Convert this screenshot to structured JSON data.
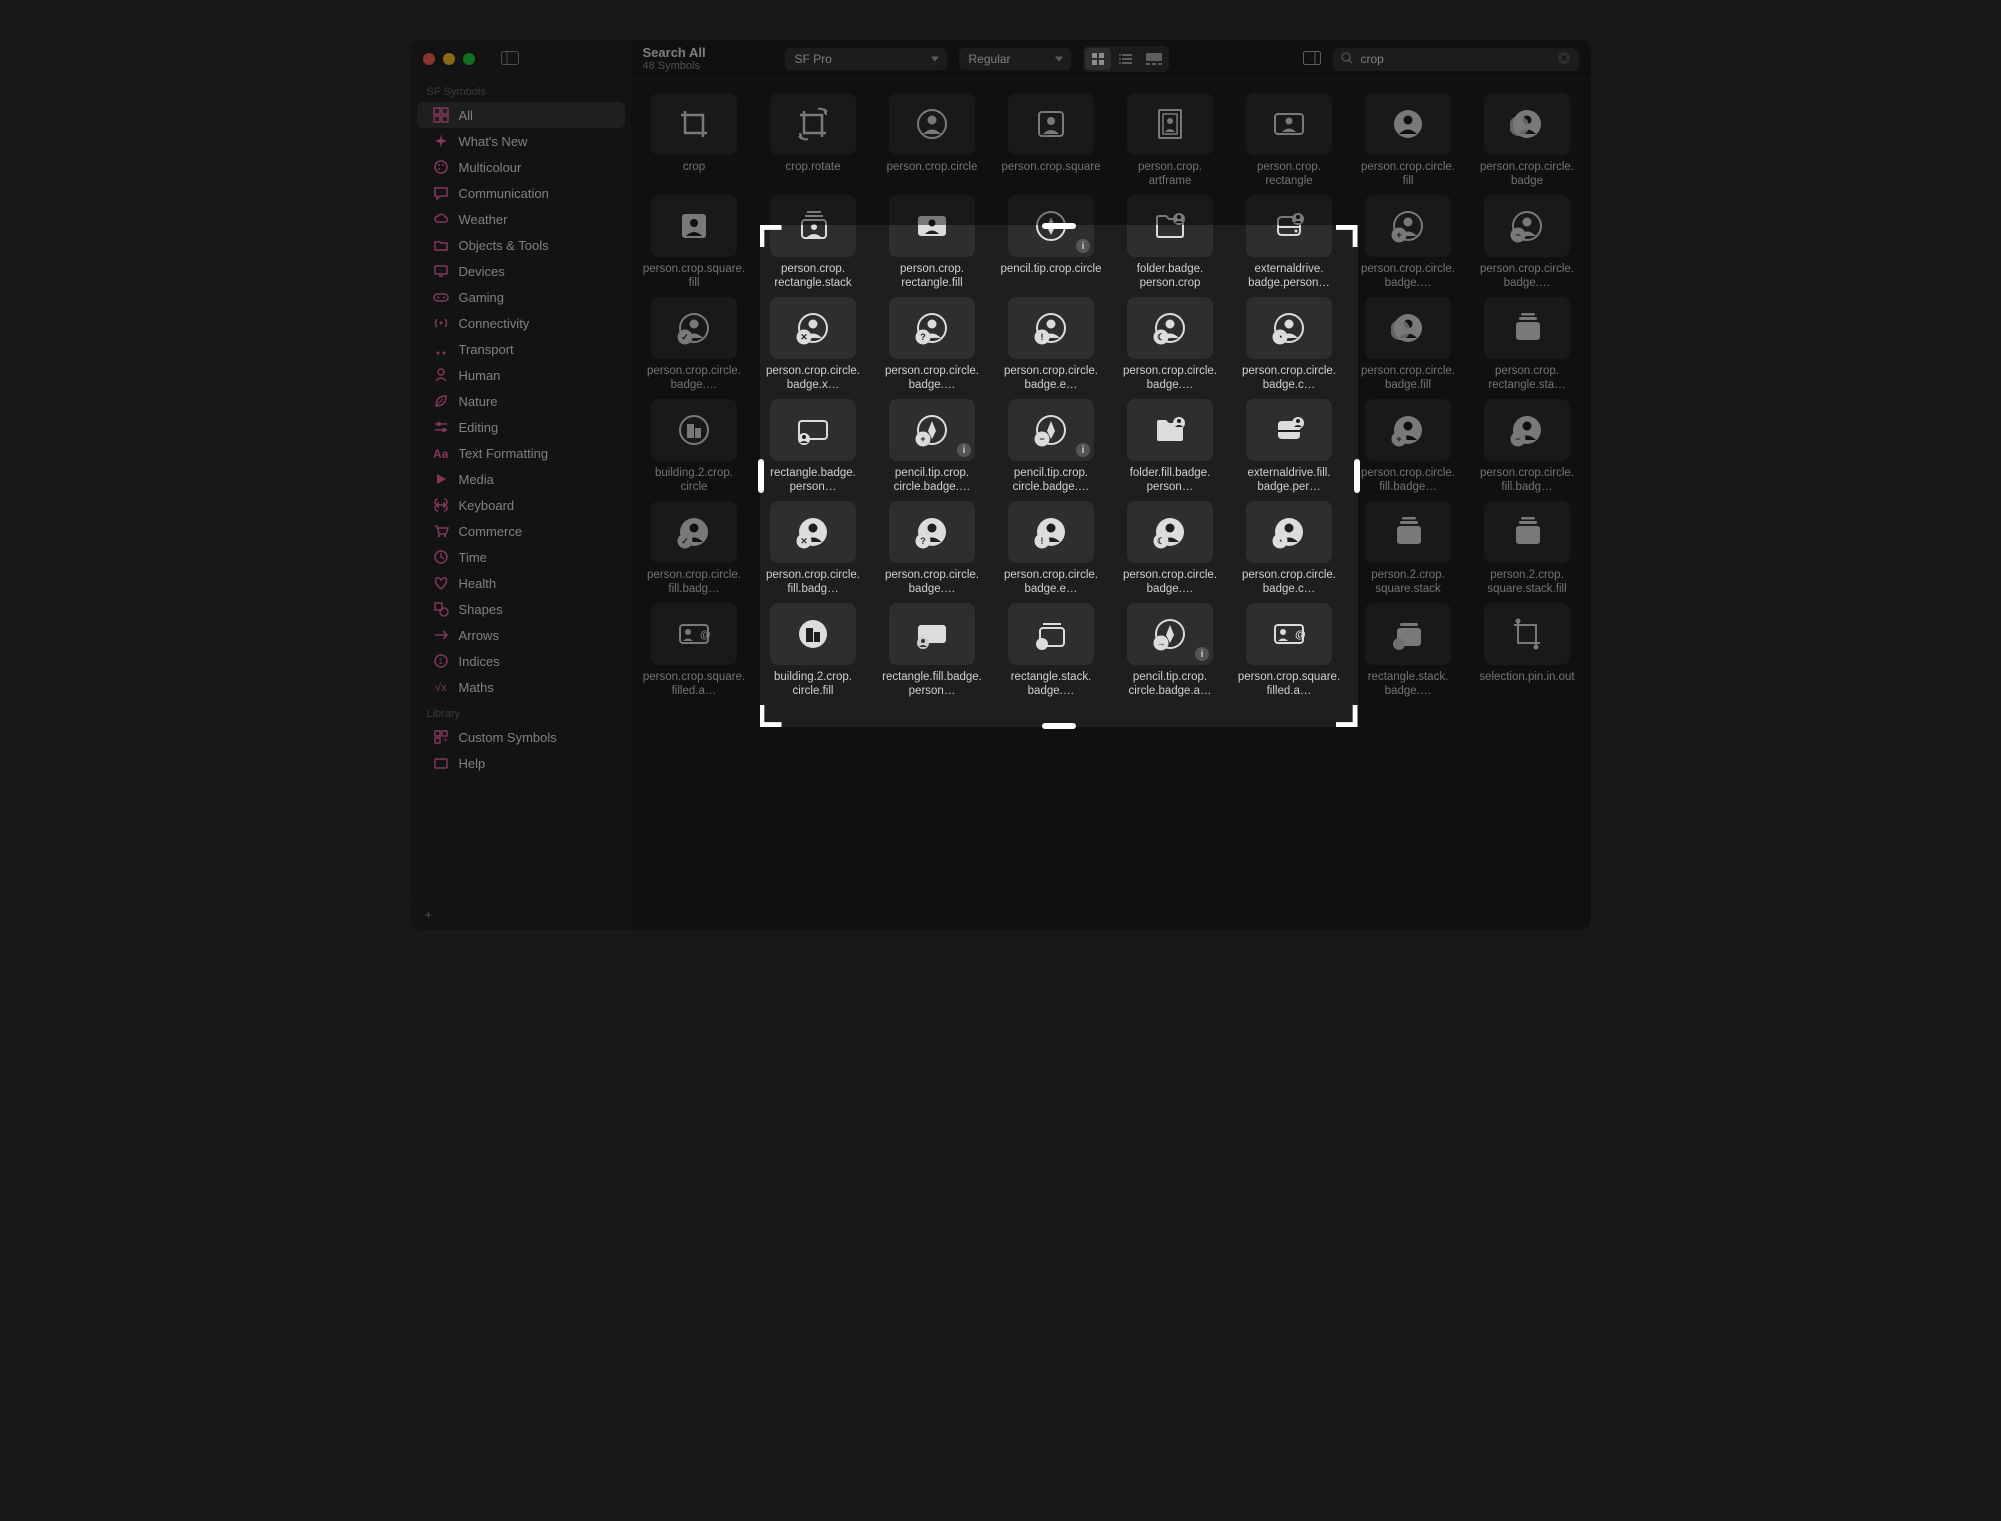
{
  "header": {
    "title": "Search All",
    "subtitle": "48 Symbols",
    "font_dropdown": "SF Pro",
    "weight_dropdown": "Regular",
    "search_value": "crop"
  },
  "sidebar": {
    "section1_label": "SF Symbols",
    "section2_label": "Library",
    "items1": [
      {
        "icon": "grid",
        "label": "All",
        "selected": true
      },
      {
        "icon": "sparkle",
        "label": "What's New"
      },
      {
        "icon": "palette",
        "label": "Multicolour"
      },
      {
        "icon": "bubble",
        "label": "Communication"
      },
      {
        "icon": "cloud",
        "label": "Weather"
      },
      {
        "icon": "folder",
        "label": "Objects & Tools"
      },
      {
        "icon": "display",
        "label": "Devices"
      },
      {
        "icon": "gamectrl",
        "label": "Gaming"
      },
      {
        "icon": "antenna",
        "label": "Connectivity"
      },
      {
        "icon": "car",
        "label": "Transport"
      },
      {
        "icon": "person",
        "label": "Human"
      },
      {
        "icon": "leaf",
        "label": "Nature"
      },
      {
        "icon": "slider",
        "label": "Editing"
      },
      {
        "icon": "textformat",
        "label": "Text Formatting"
      },
      {
        "icon": "play",
        "label": "Media"
      },
      {
        "icon": "command",
        "label": "Keyboard"
      },
      {
        "icon": "cart",
        "label": "Commerce"
      },
      {
        "icon": "clock",
        "label": "Time"
      },
      {
        "icon": "heart",
        "label": "Health"
      },
      {
        "icon": "shape",
        "label": "Shapes"
      },
      {
        "icon": "arrow",
        "label": "Arrows"
      },
      {
        "icon": "index",
        "label": "Indices"
      },
      {
        "icon": "math",
        "label": "Maths"
      }
    ],
    "items2": [
      {
        "icon": "custom",
        "label": "Custom Symbols"
      },
      {
        "icon": "help",
        "label": "Help"
      }
    ]
  },
  "symbols": [
    {
      "name": "crop",
      "i": "crop"
    },
    {
      "name": "crop.rotate",
      "i": "crop-rotate"
    },
    {
      "name": "person.crop.circle",
      "i": "pcc"
    },
    {
      "name": "person.crop.square",
      "i": "pcs"
    },
    {
      "name": "person.crop.artframe",
      "i": "paf"
    },
    {
      "name": "person.crop.rectangle",
      "i": "pcr"
    },
    {
      "name": "person.crop.circle.fill",
      "i": "pccf"
    },
    {
      "name": "person.crop.circle.badge",
      "i": "pccb"
    },
    {
      "name": "person.crop.square.fill",
      "i": "pcsf"
    },
    {
      "name": "person.crop.rectangle.stack",
      "i": "prs"
    },
    {
      "name": "person.crop.rectangle.fill",
      "i": "prf"
    },
    {
      "name": "pencil.tip.crop.circle",
      "i": "ptcc",
      "info": true
    },
    {
      "name": "folder.badge.person.crop",
      "i": "fbpc"
    },
    {
      "name": "externaldrive.badge.person.crop",
      "i": "edbp",
      "trunc": "externaldrive.badge.person…"
    },
    {
      "name": "person.crop.circle.badge.plus",
      "i": "pccbp",
      "trunc": "person.crop.circle.badge.…"
    },
    {
      "name": "person.crop.circle.badge.minus",
      "i": "pccbm",
      "trunc": "person.crop.circle.badge.…"
    },
    {
      "name": "person.crop.circle.badge.checkmark",
      "i": "pccbc",
      "trunc": "person.crop.circle.badge.…"
    },
    {
      "name": "person.crop.circle.badge.xmark",
      "i": "pccbx",
      "trunc": "person.crop.circle.badge.x…"
    },
    {
      "name": "person.crop.circle.badge.questionmark",
      "i": "pccbq",
      "trunc": "person.crop.circle.badge.…"
    },
    {
      "name": "person.crop.circle.badge.exclamationmark",
      "i": "pccbe",
      "trunc": "person.crop.circle.badge.e…"
    },
    {
      "name": "person.crop.circle.badge.moon",
      "i": "pccbmn",
      "trunc": "person.crop.circle.badge.…"
    },
    {
      "name": "person.crop.circle.badge.clock",
      "i": "pccbcl",
      "trunc": "person.crop.circle.badge.c…"
    },
    {
      "name": "person.crop.circle.badge.fill",
      "i": "pccbf"
    },
    {
      "name": "person.crop.rectangle.stack.fill",
      "i": "prsf",
      "trunc": "person.crop.rectangle.sta…"
    },
    {
      "name": "building.2.crop.circle",
      "i": "b2cc"
    },
    {
      "name": "rectangle.badge.person.crop",
      "i": "rbpc",
      "trunc": "rectangle.badge.person…"
    },
    {
      "name": "pencil.tip.crop.circle.badge.plus",
      "i": "ptccbp",
      "info": true,
      "trunc": "pencil.tip.crop.circle.badge.…"
    },
    {
      "name": "pencil.tip.crop.circle.badge.minus",
      "i": "ptccbm",
      "info": true,
      "trunc": "pencil.tip.crop.circle.badge.…"
    },
    {
      "name": "folder.fill.badge.person.crop",
      "i": "ffbpc",
      "trunc": "folder.fill.badge.person…"
    },
    {
      "name": "externaldrive.fill.badge.person.crop",
      "i": "efbpc",
      "trunc": "externaldrive.fill.badge.per…"
    },
    {
      "name": "person.crop.circle.fill.badge.plus",
      "i": "pccfbp",
      "trunc": "person.crop.circle.fill.badge…"
    },
    {
      "name": "person.crop.circle.fill.badge.minus",
      "i": "pccfbm",
      "trunc": "person.crop.circle.fill.badg…"
    },
    {
      "name": "person.crop.circle.fill.badge.checkmark",
      "i": "pccfbc",
      "trunc": "person.crop.circle.fill.badg…"
    },
    {
      "name": "person.crop.circle.fill.badge.xmark",
      "i": "pccfbx",
      "trunc": "person.crop.circle.fill.badg…"
    },
    {
      "name": "person.crop.circle.badge.questionmark.fill",
      "i": "pccbqf",
      "trunc": "person.crop.circle.badge.…"
    },
    {
      "name": "person.crop.circle.badge.exclamationmark.fill",
      "i": "pccbef",
      "trunc": "person.crop.circle.badge.e…"
    },
    {
      "name": "person.crop.circle.badge.moon.fill",
      "i": "pccbmf",
      "trunc": "person.crop.circle.badge.…"
    },
    {
      "name": "person.crop.circle.badge.clock.fill",
      "i": "pccbcf",
      "trunc": "person.crop.circle.badge.c…"
    },
    {
      "name": "person.2.crop.square.stack",
      "i": "p2css"
    },
    {
      "name": "person.2.crop.square.stack.fill",
      "i": "p2cssf"
    },
    {
      "name": "person.crop.square.filled.and.at.rectangle",
      "i": "pcsfar",
      "trunc": "person.crop.square.filled.a…"
    },
    {
      "name": "building.2.crop.circle.fill",
      "i": "b2ccf"
    },
    {
      "name": "rectangle.fill.badge.person.crop",
      "i": "rfbpc",
      "trunc": "rectangle.fill.badge.person…"
    },
    {
      "name": "rectangle.stack.badge.person.crop",
      "i": "rsbpc",
      "trunc": "rectangle.stack.badge.…"
    },
    {
      "name": "pencil.tip.crop.circle.badge.arrow.forward",
      "i": "ptccba",
      "info": true,
      "trunc": "pencil.tip.crop.circle.badge.a…"
    },
    {
      "name": "person.crop.square.filled.and.at.rectangle.fill",
      "i": "pcsfarf",
      "trunc": "person.crop.square.filled.a…"
    },
    {
      "name": "rectangle.stack.badge.person.crop.fill",
      "i": "rsbpcf",
      "trunc": "rectangle.stack.badge.…"
    },
    {
      "name": "selection.pin.in.out",
      "i": "spio"
    }
  ]
}
